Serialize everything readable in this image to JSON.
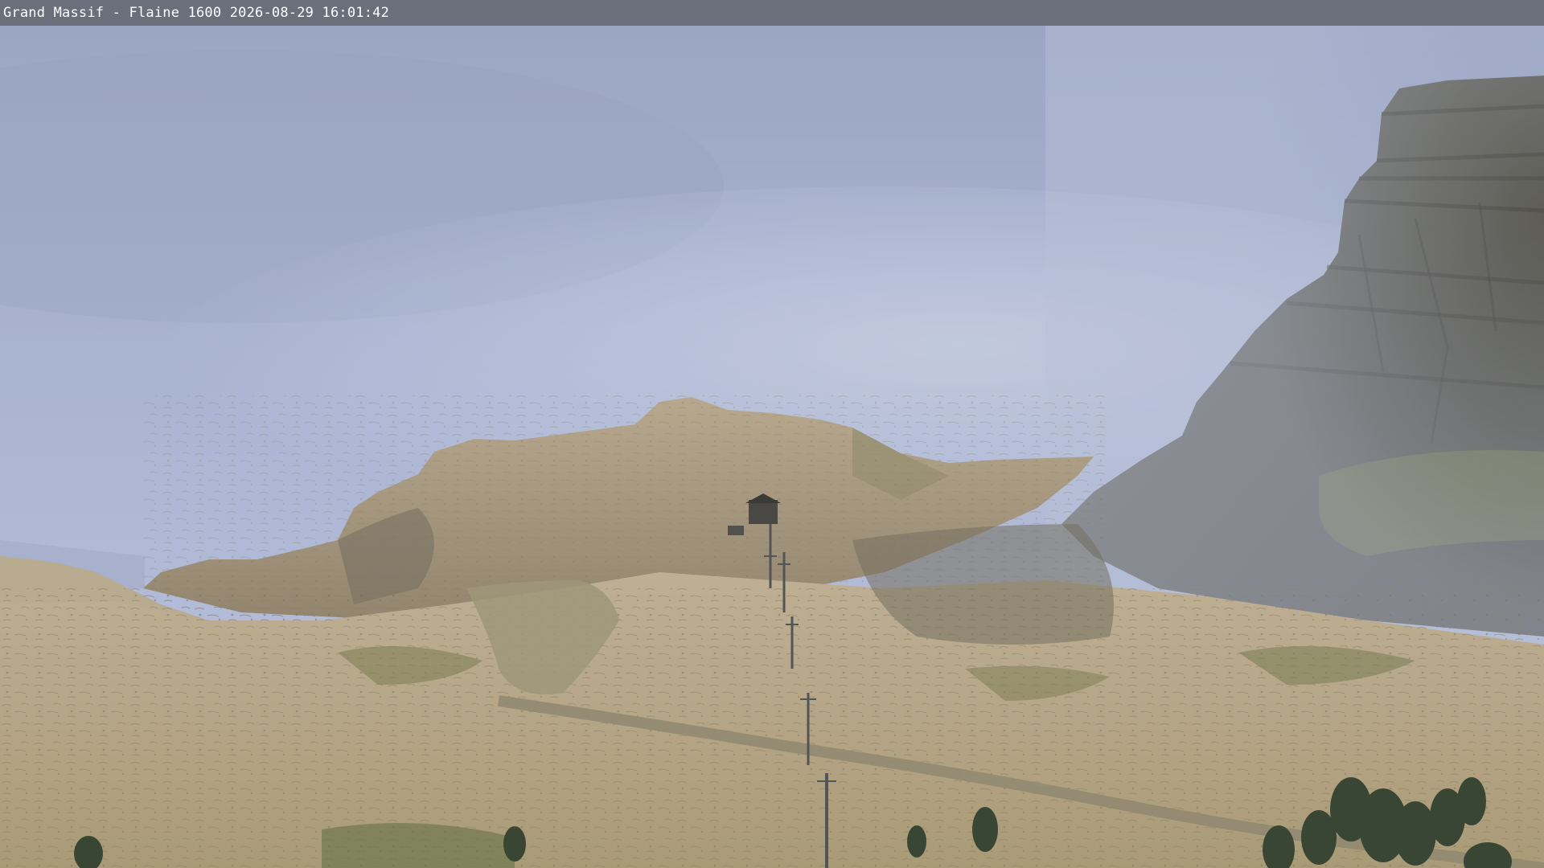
{
  "caption": {
    "text": "Grand Massif - Flaine 1600 2026-08-29 16:01:42"
  },
  "scene": {
    "subject": "webcam-view",
    "colors": {
      "caption_bar": "#6b6f7c",
      "sky_top": "#9aa4c4",
      "sky_bottom": "#b6c0dd",
      "rock_light": "#c9b99a",
      "rock_mid": "#a8957a",
      "rock_shadow": "#5f5a4f",
      "cliff_dark": "#4e4d45",
      "vegetation": "#6d7048",
      "trees": "#2e3a26",
      "lift_pylon": "#4a4a4a"
    }
  }
}
